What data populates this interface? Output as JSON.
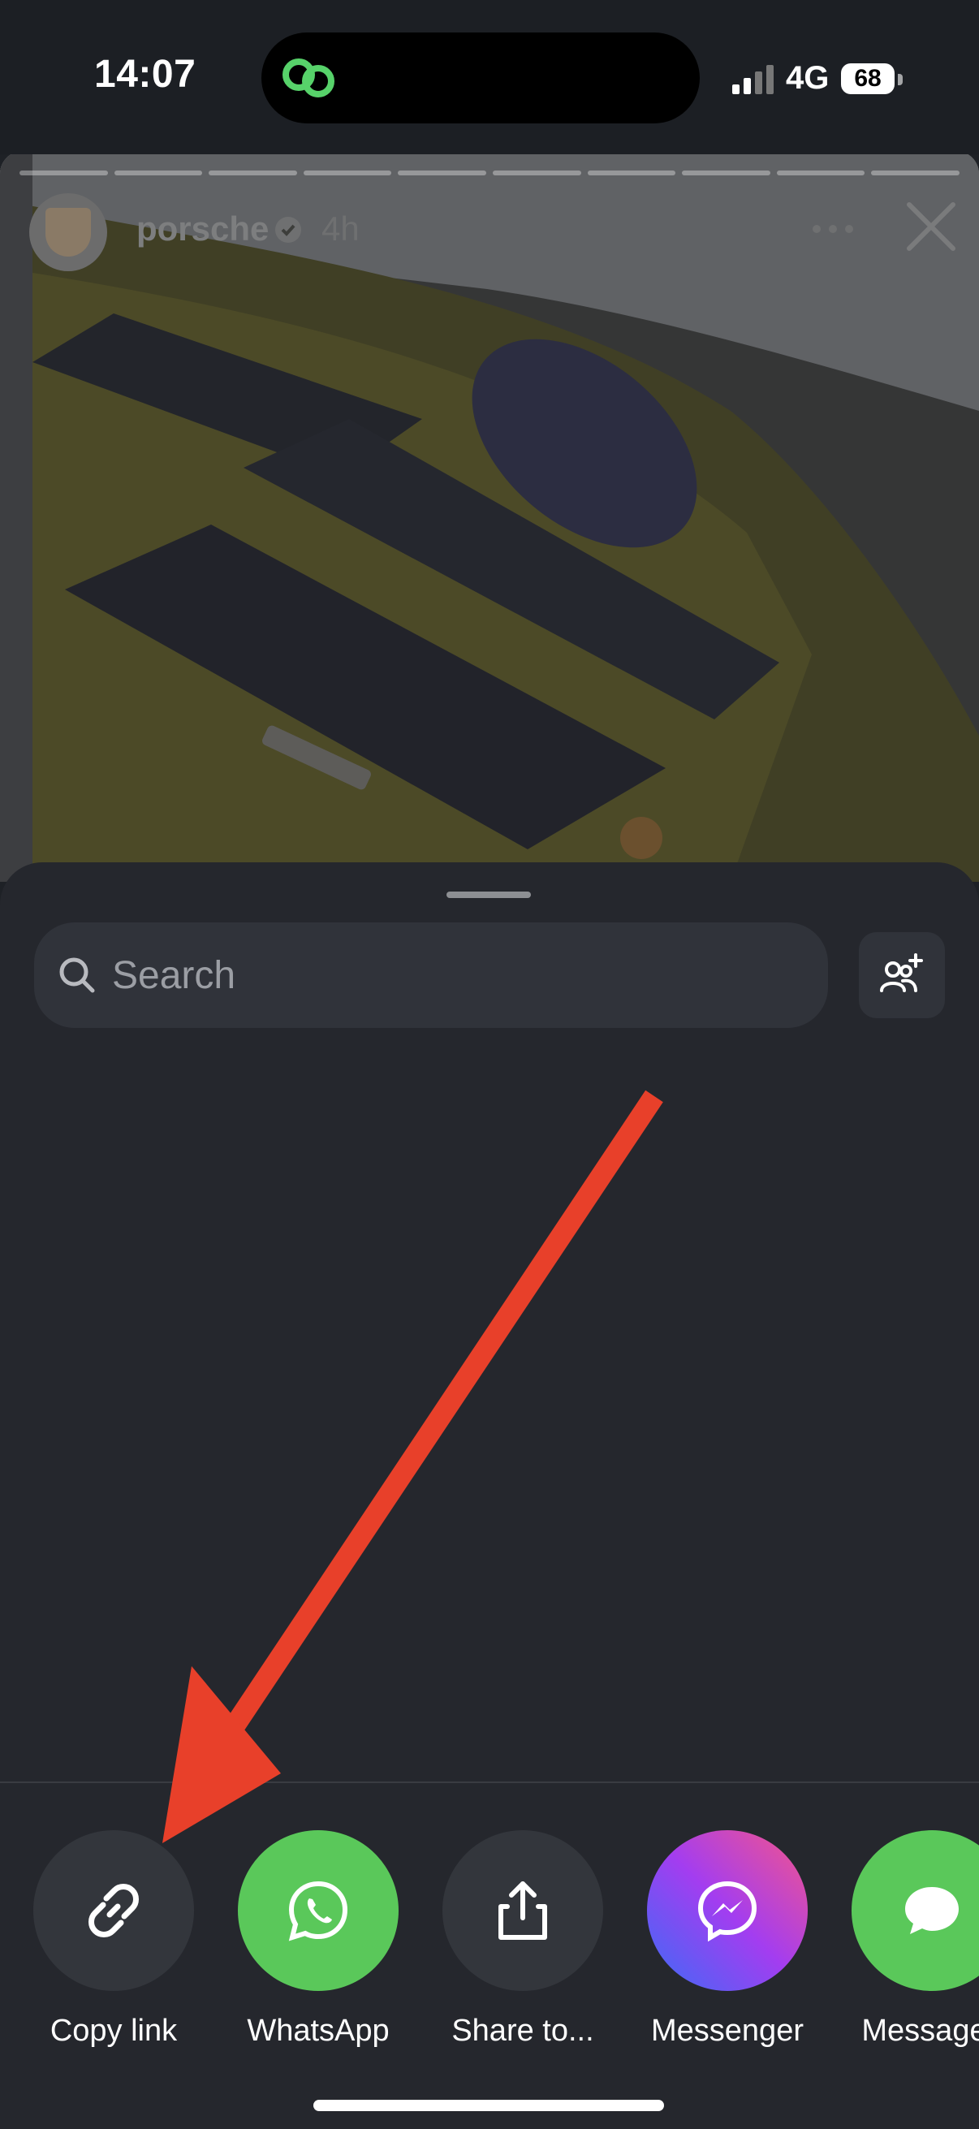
{
  "status": {
    "time": "14:07",
    "network": "4G",
    "battery": "68"
  },
  "story": {
    "username": "porsche",
    "age": "4h"
  },
  "search": {
    "placeholder": "Search"
  },
  "share_targets": [
    {
      "label": "Copy link",
      "color": "#33363c"
    },
    {
      "label": "WhatsApp",
      "color": "#5ac85a"
    },
    {
      "label": "Share to...",
      "color": "#33363c"
    },
    {
      "label": "Messenger",
      "color": "#a33df0"
    },
    {
      "label": "Messages",
      "color": "#5ac85a"
    }
  ],
  "annotation": {
    "arrow_color": "#e8402a"
  }
}
